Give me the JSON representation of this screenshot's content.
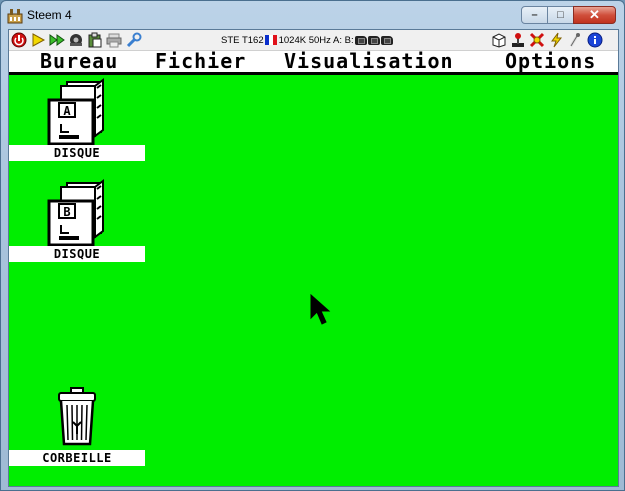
{
  "window": {
    "title": "Steem 4",
    "icon": "steem-app-icon",
    "buttons": {
      "minimize": "–",
      "maximize": "□",
      "close": "✕"
    }
  },
  "toolbar": {
    "buttons": [
      {
        "name": "power-icon"
      },
      {
        "name": "play-icon"
      },
      {
        "name": "fast-forward-icon"
      },
      {
        "name": "memory-snapshot-icon"
      },
      {
        "name": "paste-icon"
      },
      {
        "name": "printer-icon"
      },
      {
        "name": "wrench-icon"
      }
    ],
    "status": {
      "machine": "STE T162",
      "memory_freq": "1024K 50Hz A: B:"
    },
    "right_buttons": [
      {
        "name": "disk-manager-icon"
      },
      {
        "name": "joystick-icon"
      },
      {
        "name": "patches-icon"
      },
      {
        "name": "shortcuts-icon"
      },
      {
        "name": "options-icon"
      },
      {
        "name": "info-icon"
      }
    ]
  },
  "gem": {
    "menus": [
      "Bureau",
      "Fichier",
      "Visualisation",
      "Options"
    ],
    "icons": [
      {
        "name": "drive-a-icon",
        "letter": "A",
        "label": "DISQUE"
      },
      {
        "name": "drive-b-icon",
        "letter": "B",
        "label": "DISQUE"
      },
      {
        "name": "trash-icon",
        "label": "CORBEILLE"
      }
    ],
    "desktop_color": "#00EE00"
  }
}
